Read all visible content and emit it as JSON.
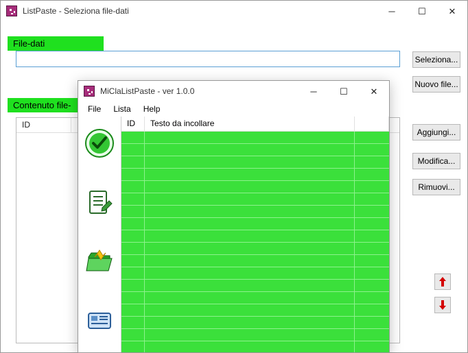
{
  "back": {
    "title": "ListPaste - Seleziona file-dati",
    "section_file": "File-dati",
    "filepath_value": "",
    "section_content": "Contenuto file-",
    "list_header_id": "ID",
    "buttons": {
      "seleziona": "Seleziona...",
      "nuovo": "Nuovo file...",
      "aggiungi": "Aggiungi...",
      "modifica": "Modifica...",
      "rimuovi": "Rimuovi..."
    }
  },
  "front": {
    "title": "MiClaListPaste - ver 1.0.0",
    "menu": {
      "file": "File",
      "lista": "Lista",
      "help": "Help"
    },
    "grid_headers": {
      "id": "ID",
      "text": "Testo da incollare"
    }
  },
  "colors": {
    "highlight": "#3be03b"
  }
}
